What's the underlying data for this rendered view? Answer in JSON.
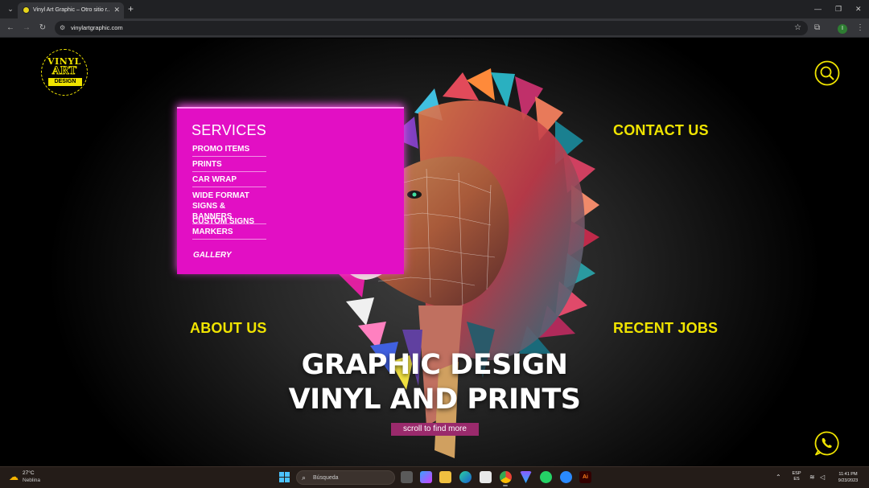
{
  "browser": {
    "tab_title": "Vinyl Art Graphic – Otro sitio r...",
    "tab_close": "✕",
    "new_tab": "+",
    "url": "vinylartgraphic.com",
    "profile_initial": "I",
    "window_controls": [
      "—",
      "❐",
      "✕"
    ]
  },
  "site": {
    "logo": {
      "line1": "VINYL",
      "line2": "ART",
      "line3": "DESIGN"
    },
    "services": {
      "title": "SERVICES",
      "items": [
        "PROMO ITEMS",
        "PRINTS",
        "CAR WRAP",
        "WIDE FORMAT\nSIGNS & BANNERS",
        "CUSTOM SIGNS\nMARKERS"
      ],
      "gallery": "GALLERY"
    },
    "nav": {
      "contact": "CONTACT US",
      "about": "ABOUT US",
      "recent": "RECENT JOBS"
    },
    "hero": {
      "line1": "GRAPHIC DESIGN",
      "line2": "VINYL AND PRINTS",
      "scroll_label": "scroll to find more"
    },
    "colors": {
      "accent": "#f0e400",
      "services_bg": "#e20fc4",
      "scroll_btn": "#9a2a6c"
    }
  },
  "taskbar": {
    "weather_temp": "27°C",
    "weather_desc": "Neblina",
    "search_placeholder": "Búsqueda",
    "lang_line1": "ESP",
    "lang_line2": "ES",
    "time": "11:41 PM",
    "date": "9/23/2023"
  }
}
